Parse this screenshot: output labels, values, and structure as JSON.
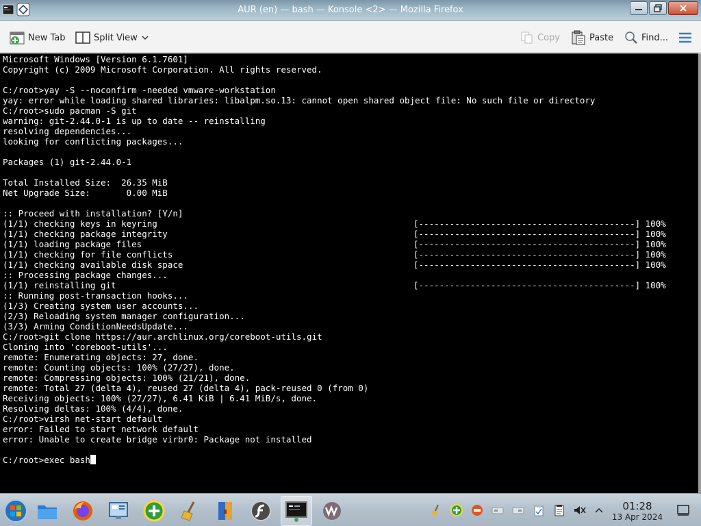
{
  "window": {
    "title": "AUR (en) — bash — Konsole <2> — Mozilla Firefox",
    "title_text_color": "#ffffff"
  },
  "toolbar": {
    "new_tab": "New Tab",
    "split_view": "Split View",
    "copy": "Copy",
    "paste": "Paste",
    "find": "Find..."
  },
  "terminal": {
    "background": "#000000",
    "foreground": "#ffffff",
    "lines": [
      {
        "text": "Microsoft Windows [Version 6.1.7601]",
        "progress": ""
      },
      {
        "text": "Copyright (c) 2009 Microsoft Corporation. All rights reserved.",
        "progress": ""
      },
      {
        "text": "",
        "progress": ""
      },
      {
        "text": "C:/root>yay -S --noconfirm -needed vmware-workstation",
        "progress": ""
      },
      {
        "text": "yay: error while loading shared libraries: libalpm.so.13: cannot open shared object file: No such file or directory",
        "progress": ""
      },
      {
        "text": "C:/root>sudo pacman -S git",
        "progress": ""
      },
      {
        "text": "warning: git-2.44.0-1 is up to date -- reinstalling",
        "progress": ""
      },
      {
        "text": "resolving dependencies...",
        "progress": ""
      },
      {
        "text": "looking for conflicting packages...",
        "progress": ""
      },
      {
        "text": "",
        "progress": ""
      },
      {
        "text": "Packages (1) git-2.44.0-1",
        "progress": ""
      },
      {
        "text": "",
        "progress": ""
      },
      {
        "text": "Total Installed Size:  26.35 MiB",
        "progress": ""
      },
      {
        "text": "Net Upgrade Size:       0.00 MiB",
        "progress": ""
      },
      {
        "text": "",
        "progress": ""
      },
      {
        "text": ":: Proceed with installation? [Y/n]",
        "progress": ""
      },
      {
        "text": "(1/1) checking keys in keyring",
        "progress": "[------------------------------------------] 100%"
      },
      {
        "text": "(1/1) checking package integrity",
        "progress": "[------------------------------------------] 100%"
      },
      {
        "text": "(1/1) loading package files",
        "progress": "[------------------------------------------] 100%"
      },
      {
        "text": "(1/1) checking for file conflicts",
        "progress": "[------------------------------------------] 100%"
      },
      {
        "text": "(1/1) checking available disk space",
        "progress": "[------------------------------------------] 100%"
      },
      {
        "text": ":: Processing package changes...",
        "progress": ""
      },
      {
        "text": "(1/1) reinstalling git",
        "progress": "[------------------------------------------] 100%"
      },
      {
        "text": ":: Running post-transaction hooks...",
        "progress": ""
      },
      {
        "text": "(1/3) Creating system user accounts...",
        "progress": ""
      },
      {
        "text": "(2/3) Reloading system manager configuration...",
        "progress": ""
      },
      {
        "text": "(3/3) Arming ConditionNeedsUpdate...",
        "progress": ""
      },
      {
        "text": "C:/root>git clone https://aur.archlinux.org/coreboot-utils.git",
        "progress": ""
      },
      {
        "text": "Cloning into 'coreboot-utils'...",
        "progress": ""
      },
      {
        "text": "remote: Enumerating objects: 27, done.",
        "progress": ""
      },
      {
        "text": "remote: Counting objects: 100% (27/27), done.",
        "progress": ""
      },
      {
        "text": "remote: Compressing objects: 100% (21/21), done.",
        "progress": ""
      },
      {
        "text": "remote: Total 27 (delta 4), reused 27 (delta 4), pack-reused 0 (from 0)",
        "progress": ""
      },
      {
        "text": "Receiving objects: 100% (27/27), 6.41 KiB | 6.41 MiB/s, done.",
        "progress": ""
      },
      {
        "text": "Resolving deltas: 100% (4/4), done.",
        "progress": ""
      },
      {
        "text": "C:/root>virsh net-start default",
        "progress": ""
      },
      {
        "text": "error: Failed to start network default",
        "progress": ""
      },
      {
        "text": "error: Unable to create bridge virbr0: Package not installed",
        "progress": ""
      },
      {
        "text": "",
        "progress": ""
      }
    ],
    "prompt_line": "C:/root>exec bash"
  },
  "taskbar": {
    "apps": [
      {
        "name": "start-orb"
      },
      {
        "name": "file-explorer"
      },
      {
        "name": "firefox"
      },
      {
        "name": "control-panel"
      },
      {
        "name": "add-app"
      },
      {
        "name": "cleanup"
      },
      {
        "name": "books"
      },
      {
        "name": "flash-player"
      },
      {
        "name": "konsole",
        "active": true
      },
      {
        "name": "vmware"
      }
    ],
    "clock": {
      "time": "01:28",
      "date": "13 Apr 2024"
    }
  }
}
